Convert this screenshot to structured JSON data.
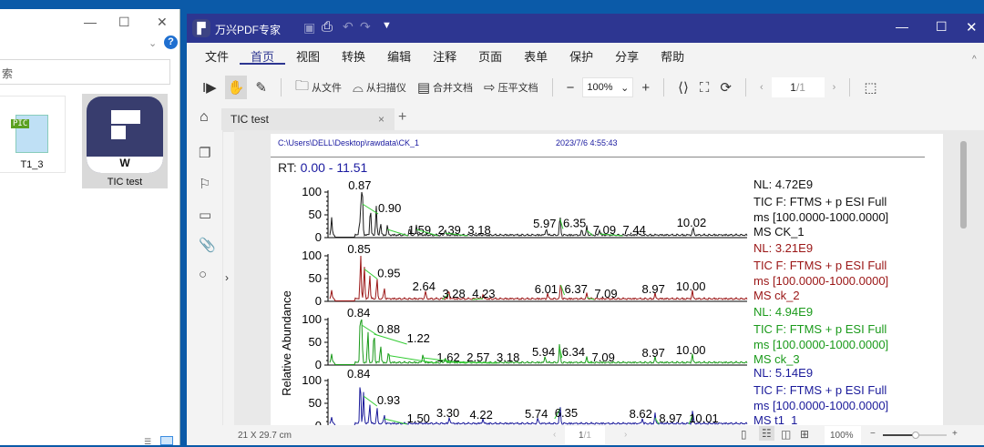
{
  "explorer": {
    "search_hint": "索",
    "files": [
      {
        "name": "T1_3",
        "icon": "pic-file-icon",
        "badge": "PIC"
      },
      {
        "name": "TIC test",
        "icon": "wondershare-pdf-icon"
      }
    ]
  },
  "app": {
    "title": "万兴PDF专家",
    "menus": [
      "文件",
      "首页",
      "视图",
      "转换",
      "编辑",
      "注释",
      "页面",
      "表单",
      "保护",
      "分享",
      "帮助"
    ],
    "active_menu": "首页",
    "toolbar": {
      "from_file": "从文件",
      "from_scanner": "从扫描仪",
      "merge": "合并文档",
      "flatten": "压平文档",
      "zoom": "100%",
      "page_current": "1",
      "page_total": "/1"
    },
    "tab": "TIC test"
  },
  "status": {
    "page_size": "21 X 29.7 cm",
    "page": "1",
    "page_total": "/1",
    "zoom": "100%"
  },
  "document": {
    "path": "C:\\Users\\DELL\\Desktop\\rawdata\\CK_1",
    "datetime": "2023/7/6 4:55:43",
    "rt_label": "RT:",
    "rt_range": "0.00 - 11.51",
    "y_label": "Relative Abundance"
  },
  "chart_data": {
    "type": "line",
    "rt_range": [
      0,
      11.51
    ],
    "ylim": [
      0,
      100
    ],
    "yticks": [
      0,
      50,
      100
    ],
    "ylabel": "Relative Abundance",
    "series": [
      {
        "name": "CK_1",
        "color": "#1a1a1a",
        "nl": "NL: 4.72E9",
        "info": [
          "TIC F: FTMS + p ESI Full",
          "ms [100.0000-1000.0000]",
          "MS CK_1"
        ],
        "peaks": [
          [
            0.05,
            40
          ],
          [
            0.82,
            30
          ],
          [
            0.87,
            100,
            "0.87"
          ],
          [
            0.9,
            78,
            "0.90"
          ],
          [
            1.12,
            62
          ],
          [
            1.28,
            66
          ],
          [
            1.4,
            28
          ],
          [
            1.59,
            22,
            "1.59"
          ],
          [
            2.2,
            15
          ],
          [
            2.39,
            22,
            "2.39"
          ],
          [
            3.18,
            14,
            "3.18"
          ],
          [
            5.97,
            16,
            "5.97"
          ],
          [
            6.35,
            45,
            "6.35"
          ],
          [
            6.95,
            12
          ],
          [
            7.09,
            20,
            "7.09"
          ],
          [
            7.44,
            12,
            "7.44"
          ],
          [
            8.5,
            6
          ],
          [
            10.02,
            18,
            "10.02"
          ]
        ]
      },
      {
        "name": "ck_2",
        "color": "#9a1515",
        "nl": "NL: 3.21E9",
        "info": [
          "TIC F: FTMS + p ESI Full",
          "ms [100.0000-1000.0000]",
          "MS ck_2"
        ],
        "peaks": [
          [
            0.05,
            20
          ],
          [
            0.85,
            100,
            "0.85"
          ],
          [
            0.95,
            75,
            "0.95"
          ],
          [
            1.1,
            55
          ],
          [
            1.3,
            45
          ],
          [
            1.5,
            25
          ],
          [
            2.64,
            18,
            "2.64"
          ],
          [
            3.28,
            20,
            "3.28"
          ],
          [
            4.23,
            10,
            "4.23"
          ],
          [
            6.01,
            12,
            "6.01"
          ],
          [
            6.37,
            40,
            "6.37"
          ],
          [
            7.09,
            12,
            "7.09"
          ],
          [
            8.97,
            12,
            "8.97"
          ],
          [
            10.0,
            18,
            "10.00"
          ]
        ]
      },
      {
        "name": "ck_3",
        "color": "#1a9a1a",
        "nl": "NL: 4.94E9",
        "info": [
          "TIC F: FTMS + p ESI Full",
          "ms [100.0000-1000.0000]",
          "MS ck_3"
        ],
        "peaks": [
          [
            0.05,
            20
          ],
          [
            0.84,
            100,
            "0.84"
          ],
          [
            0.88,
            92,
            "0.88"
          ],
          [
            1.05,
            70
          ],
          [
            1.22,
            72,
            "1.22"
          ],
          [
            1.4,
            40
          ],
          [
            1.62,
            25,
            "1.62"
          ],
          [
            2.57,
            20,
            "2.57"
          ],
          [
            3.18,
            12,
            "3.18"
          ],
          [
            5.94,
            14,
            "5.94"
          ],
          [
            6.34,
            42,
            "6.34"
          ],
          [
            7.09,
            12,
            "7.09"
          ],
          [
            8.97,
            12,
            "8.97"
          ],
          [
            10.0,
            18,
            "10.00"
          ]
        ]
      },
      {
        "name": "t1_1",
        "color": "#1a1a9a",
        "nl": "NL: 5.14E9",
        "info": [
          "TIC F: FTMS + p ESI Full",
          "ms [100.0000-1000.0000]",
          "MS t1_1"
        ],
        "peaks": [
          [
            0.05,
            15
          ],
          [
            0.84,
            100,
            "0.84"
          ],
          [
            0.93,
            70,
            "0.93"
          ],
          [
            1.1,
            45
          ],
          [
            1.3,
            35
          ],
          [
            1.5,
            20,
            "1.50"
          ],
          [
            3.3,
            14,
            "3.30"
          ],
          [
            4.22,
            10,
            "4.22"
          ],
          [
            5.74,
            12,
            "5.74"
          ],
          [
            6.35,
            42,
            "6.35"
          ],
          [
            8.62,
            12,
            "8.62"
          ],
          [
            8.97,
            22,
            "8.97"
          ],
          [
            10.01,
            30,
            "10.01"
          ]
        ]
      }
    ]
  }
}
